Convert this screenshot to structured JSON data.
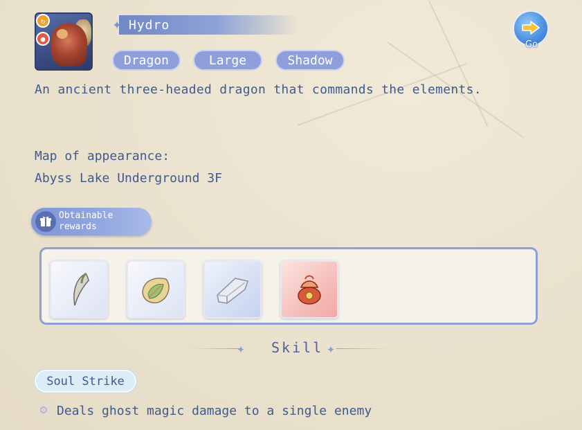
{
  "monster": {
    "element": "Hydro",
    "tags": [
      "Dragon",
      "Large",
      "Shadow"
    ],
    "description": "An ancient three-headed dragon that commands the elements.",
    "map_label": "Map of appearance:",
    "map_value": "Abyss Lake Underground 3F"
  },
  "go_button": {
    "label": "Go"
  },
  "rewards": {
    "button_label": "Obtainable rewards",
    "items": [
      "claw-icon",
      "leaf-fossil-icon",
      "stone-slab-icon",
      "treasure-pouch-icon"
    ]
  },
  "skill": {
    "header": "Skill",
    "name": "Soul Strike",
    "description": "Deals ghost magic damage to a single enemy"
  },
  "colors": {
    "accent": "#8f9fdc",
    "text": "#3f5a8f",
    "background": "#ebe3cf"
  }
}
